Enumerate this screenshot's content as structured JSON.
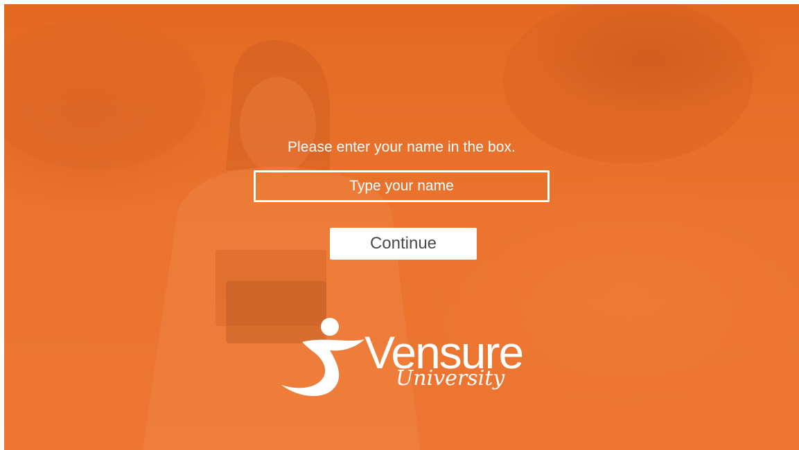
{
  "prompt_text": "Please enter your name in the box.",
  "name_input": {
    "placeholder": "Type your name",
    "value": ""
  },
  "continue_label": "Continue",
  "logo": {
    "wordmark": "Vensure",
    "subtitle": "University"
  },
  "colors": {
    "overlay_orange": "#e8722e",
    "text": "#ffffff",
    "button_bg": "#ffffff",
    "button_text": "#4a4a4a"
  }
}
